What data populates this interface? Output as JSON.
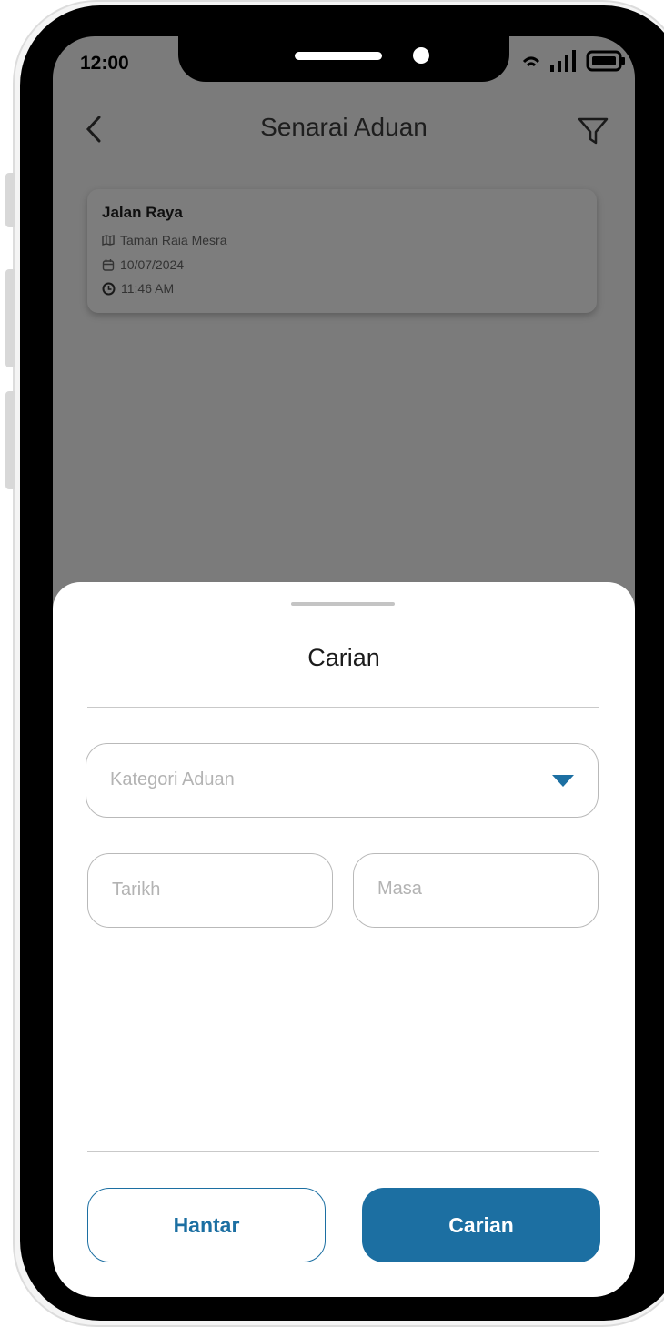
{
  "status_bar": {
    "time": "12:00"
  },
  "header": {
    "title": "Senarai Aduan"
  },
  "complaints": [
    {
      "title": "Jalan Raya",
      "location": "Taman Raia Mesra",
      "date": "10/07/2024",
      "time": "11:46 AM"
    }
  ],
  "search_sheet": {
    "title": "Carian",
    "category_placeholder": "Kategori Aduan",
    "date_placeholder": "Tarikh",
    "time_placeholder": "Masa",
    "submit_label": "Hantar",
    "search_label": "Carian"
  },
  "colors": {
    "accent": "#1c6fa2",
    "overlay": "#7b7b7b"
  },
  "icons": [
    "back-icon",
    "filter-icon",
    "map-icon",
    "calendar-icon",
    "clock-icon",
    "wifi-icon",
    "signal-icon",
    "battery-icon",
    "dropdown-arrow-icon"
  ]
}
